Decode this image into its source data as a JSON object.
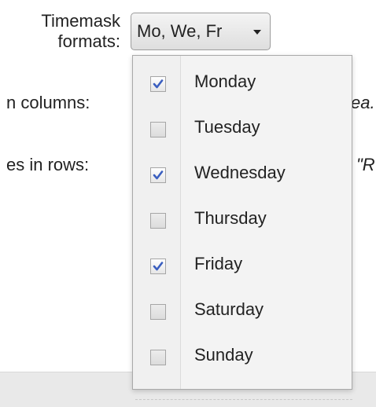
{
  "form": {
    "timemask_label_line1": "Timemask",
    "timemask_label_line2": "formats:",
    "columns_label": "n columns:",
    "columns_trailing": "ea.",
    "rows_label": "es in rows:",
    "rows_trailing": "\"R"
  },
  "select": {
    "value": "Mo, We, Fr"
  },
  "dropdown": {
    "options": [
      {
        "label": "Monday",
        "checked": true
      },
      {
        "label": "Tuesday",
        "checked": false
      },
      {
        "label": "Wednesday",
        "checked": true
      },
      {
        "label": "Thursday",
        "checked": false
      },
      {
        "label": "Friday",
        "checked": true
      },
      {
        "label": "Saturday",
        "checked": false
      },
      {
        "label": "Sunday",
        "checked": false
      }
    ]
  },
  "colors": {
    "check_mark": "#3b5fc0",
    "checkbox_border": "#a6a6a6",
    "dropdown_bg": "#f3f3f3"
  }
}
